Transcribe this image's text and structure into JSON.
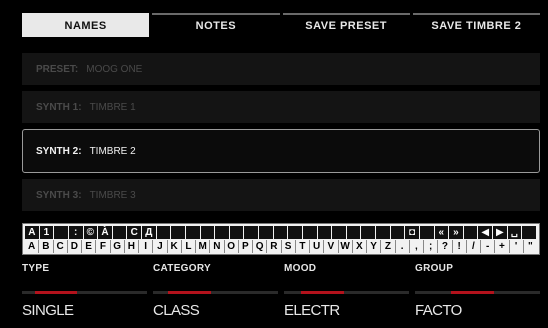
{
  "tabs": [
    {
      "label": "NAMES",
      "active": true
    },
    {
      "label": "NOTES",
      "active": false
    },
    {
      "label": "SAVE PRESET",
      "active": false
    },
    {
      "label": "SAVE TIMBRE 2",
      "active": false
    }
  ],
  "rows": [
    {
      "label": "PRESET:",
      "value": "MOOG ONE",
      "selected": false
    },
    {
      "label": "SYNTH 1:",
      "value": "TIMBRE 1",
      "selected": false
    },
    {
      "label": "SYNTH 2:",
      "value": "TIMBRE 2",
      "selected": true
    },
    {
      "label": "SYNTH 3:",
      "value": "TIMBRE 3",
      "selected": false
    }
  ],
  "keyboard": {
    "top_row": [
      "A",
      "1",
      "",
      ":",
      "©",
      "À",
      "",
      "С",
      "Д",
      "",
      "",
      "",
      "",
      "",
      "",
      "",
      "",
      "",
      "",
      "",
      "",
      "",
      "",
      "",
      "",
      "",
      "◘",
      "",
      "«",
      "»",
      "",
      "◀",
      "▶",
      "␣",
      ""
    ],
    "bottom_row": [
      "A",
      "B",
      "C",
      "D",
      "E",
      "F",
      "G",
      "H",
      "I",
      "J",
      "K",
      "L",
      "M",
      "N",
      "O",
      "P",
      "Q",
      "R",
      "S",
      "T",
      "U",
      "V",
      "W",
      "X",
      "Y",
      "Z",
      ".",
      ",",
      ";",
      "?",
      "!",
      "/",
      "-",
      "+",
      "'",
      "\""
    ]
  },
  "attributes": [
    {
      "label": "TYPE",
      "value": "SINGLE",
      "level": 0.17
    },
    {
      "label": "CATEGORY",
      "value": "CLASS",
      "level": 0.2
    },
    {
      "label": "MOOD",
      "value": "ELECTR",
      "level": 0.23
    },
    {
      "label": "GROUP",
      "value": "FACTO",
      "level": 0.48
    }
  ],
  "colors": {
    "accent_red": "#b3121c",
    "active_tab_bg": "#e9e9e9"
  }
}
